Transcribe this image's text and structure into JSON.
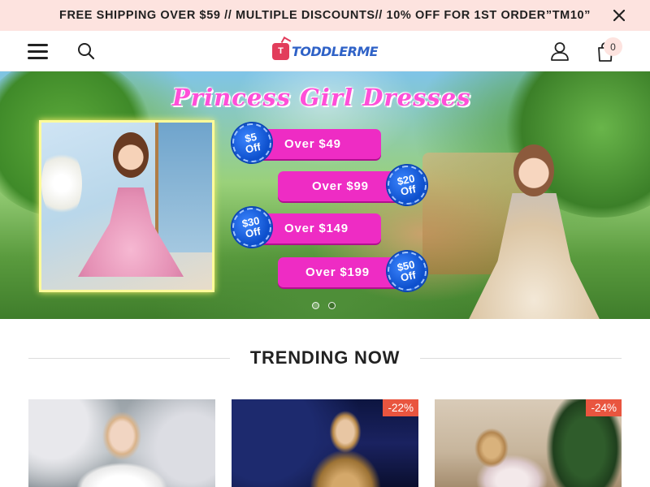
{
  "announcement": {
    "text": "FREE SHIPPING OVER $59 // MULTIPLE DISCOUNTS// 10% OFF FOR 1ST ORDER”TM10”"
  },
  "header": {
    "logo_badge": "T",
    "logo_text": "TODDLERME",
    "cart_count": "0",
    "icons": [
      "hamburger-menu-icon",
      "search-icon",
      "account-icon",
      "cart-icon",
      "close-icon"
    ]
  },
  "hero": {
    "title": "Princess Girl Dresses",
    "deals": [
      {
        "amount": "$5",
        "off": "Off",
        "label": "Over $49"
      },
      {
        "amount": "$20",
        "off": "Off",
        "label": "Over $99"
      },
      {
        "amount": "$30",
        "off": "Off",
        "label": "Over $149"
      },
      {
        "amount": "$50",
        "off": "Off",
        "label": "Over $199"
      }
    ],
    "slide_count": 2,
    "active_slide": 1
  },
  "trending": {
    "title": "TRENDING NOW",
    "products": [
      {
        "discount": ""
      },
      {
        "discount": "-22%"
      },
      {
        "discount": "-24%"
      }
    ]
  },
  "colors": {
    "announcement_bg": "#fde3df",
    "deal_pink": "#ee2cc4",
    "badge_blue": "#1a5fe0",
    "discount_badge": "#e9553f",
    "logo_blue": "#2f62c7",
    "logo_red": "#e23d5b"
  }
}
